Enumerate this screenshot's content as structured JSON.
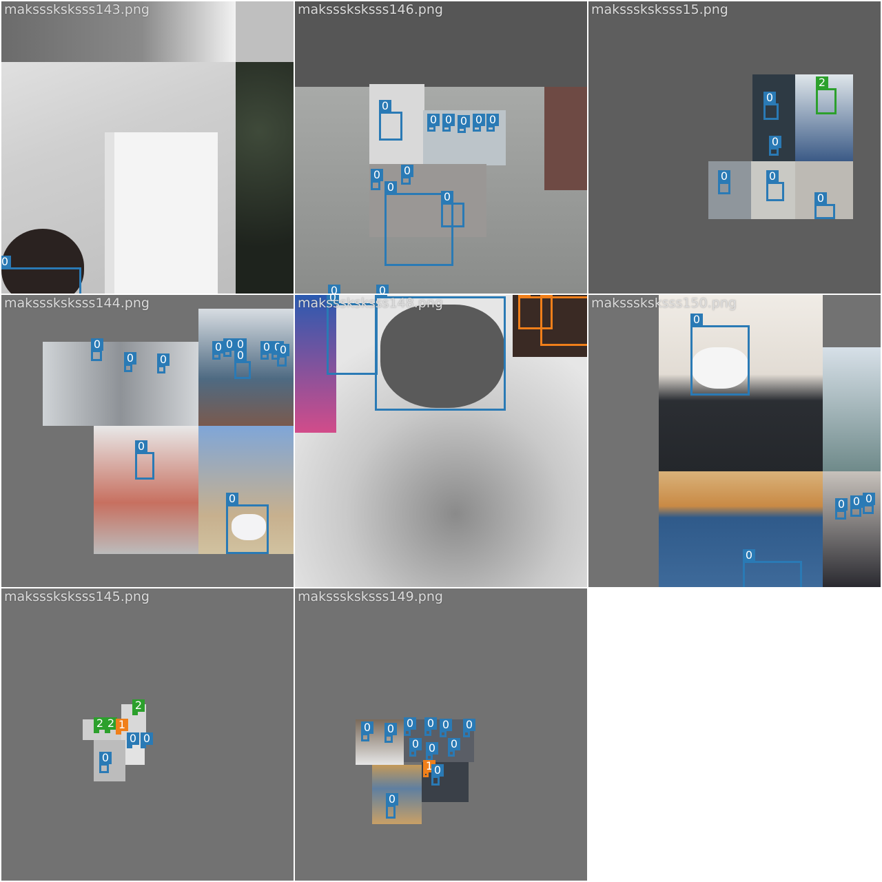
{
  "mosaic": {
    "tiles": [
      {
        "filename": "maksssksksss143.png",
        "labels": [
          "0"
        ]
      },
      {
        "filename": "maksssksksss146.png",
        "labels": [
          "0",
          "0",
          "0",
          "0",
          "0",
          "0",
          "0",
          "0",
          "0",
          "0",
          "0",
          "0"
        ]
      },
      {
        "filename": "maksssksksss15.png",
        "labels": [
          "2",
          "0",
          "0",
          "0",
          "0",
          "0"
        ]
      },
      {
        "filename": "maksssksksss144.png",
        "labels": [
          "0",
          "0",
          "0",
          "0",
          "0",
          "0",
          "0",
          "0",
          "0",
          "0",
          "0",
          "0"
        ]
      },
      {
        "filename": "maksssksksss148.png",
        "labels": [
          "0",
          "0",
          "1",
          "1"
        ]
      },
      {
        "filename": "maksssksksss150.png",
        "labels": [
          "0",
          "0",
          "0",
          "0",
          "0"
        ]
      },
      {
        "filename": "maksssksksss145.png",
        "labels": [
          "2",
          "2",
          "1",
          "2",
          "0",
          "0",
          "0"
        ]
      },
      {
        "filename": "maksssksksss149.png",
        "labels": [
          "0",
          "0",
          "0",
          "0",
          "0",
          "0",
          "0",
          "0",
          "0",
          "1",
          "0",
          "0"
        ]
      }
    ]
  },
  "colors": {
    "class_0": "#2a7ab5",
    "class_1": "#f07f1a",
    "class_2": "#2ca02c",
    "padding_gray": "#727272",
    "background": "#ffffff"
  }
}
